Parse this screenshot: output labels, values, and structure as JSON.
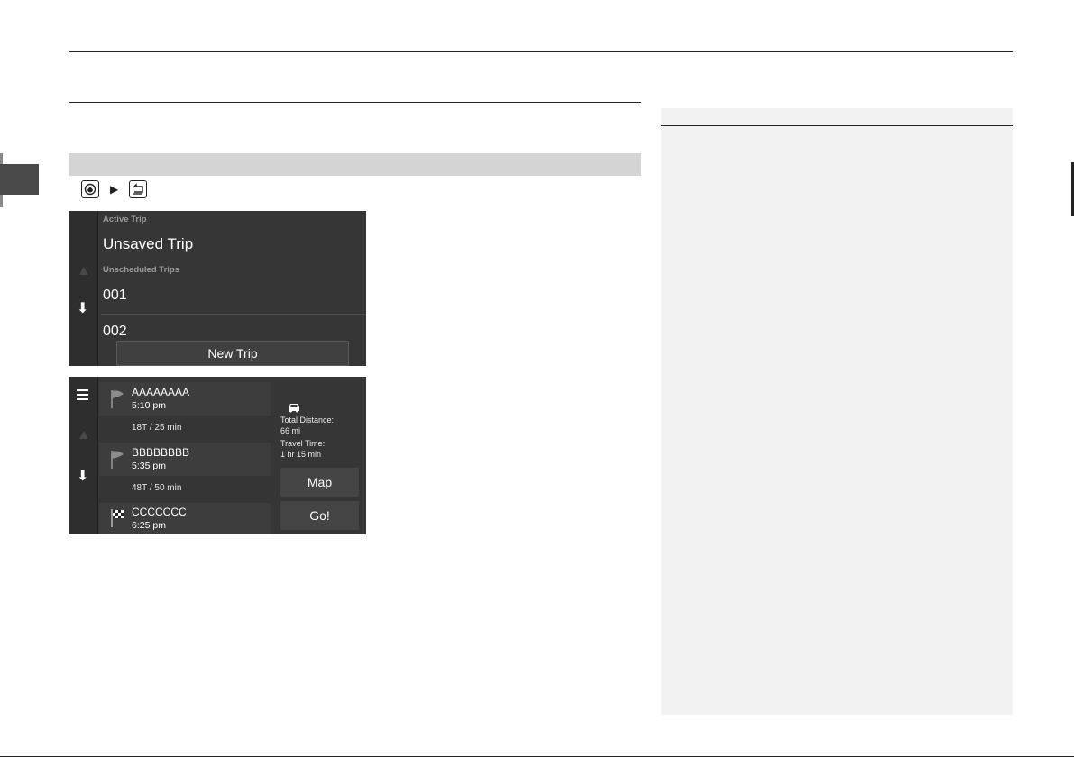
{
  "toolbar_icons": [
    {
      "icon": "home-icon"
    },
    {
      "icon": "back-icon"
    }
  ],
  "screen1": {
    "section_active": "Active Trip",
    "active_trip": "Unsaved Trip",
    "section_unscheduled": "Unscheduled Trips",
    "trips": [
      "001",
      "002"
    ],
    "new_trip_button": "New Trip"
  },
  "screen2": {
    "stops": [
      {
        "name": "AAAAAAAA",
        "time": "5:10 pm",
        "flag": "flag-icon"
      },
      {
        "name": "BBBBBBBB",
        "time": "5:35 pm",
        "flag": "flag-icon"
      },
      {
        "name": "CCCCCCC",
        "time": "6:25 pm",
        "flag": "checkered-flag-icon"
      }
    ],
    "legs": [
      "18T / 25 min",
      "48T / 50 min"
    ],
    "total_distance_label": "Total Distance:",
    "total_distance_value": "66 mi",
    "travel_time_label": "Travel Time:",
    "travel_time_value": "1 hr 15 min",
    "map_button": "Map",
    "go_button": "Go!"
  },
  "colors": {
    "screen_bg": "#363636",
    "band": "#d4d4d4",
    "note_panel": "#f2f2f2"
  }
}
